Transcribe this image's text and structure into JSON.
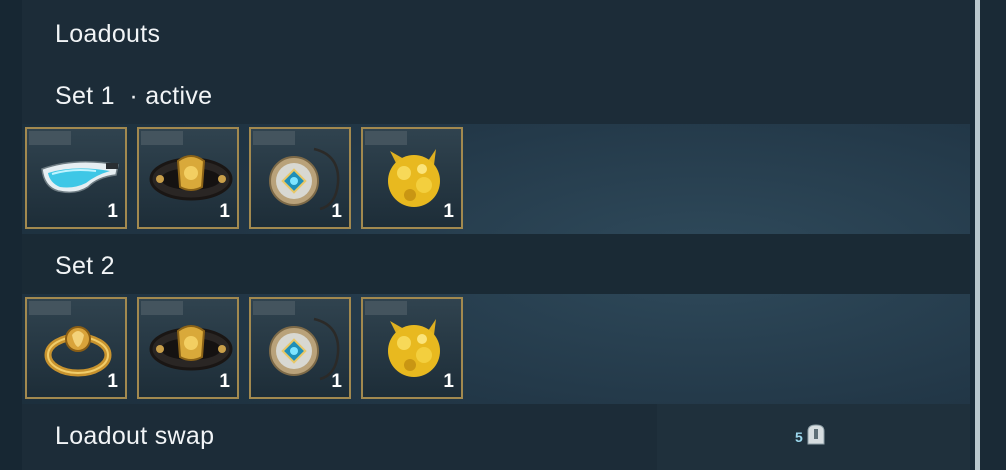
{
  "header": {
    "title": "Loadouts"
  },
  "sets": [
    {
      "label": "Set 1",
      "status": "· active",
      "slots": [
        {
          "icon": "visor-glasses-icon",
          "count": "1"
        },
        {
          "icon": "gold-bracer-icon",
          "count": "1"
        },
        {
          "icon": "medallion-pendant-icon",
          "count": "1"
        },
        {
          "icon": "gold-ore-charm-icon",
          "count": "1"
        }
      ]
    },
    {
      "label": "Set 2",
      "slots": [
        {
          "icon": "golden-ring-icon",
          "count": "1"
        },
        {
          "icon": "gold-bracer-icon",
          "count": "1"
        },
        {
          "icon": "medallion-pendant-icon",
          "count": "1"
        },
        {
          "icon": "gold-ore-charm-icon",
          "count": "1"
        }
      ]
    }
  ],
  "swap": {
    "label": "Loadout swap",
    "cost": "5",
    "cost_icon": "key-token-icon"
  },
  "colors": {
    "slot_border": "#a2894f",
    "panel": "#1c2c38",
    "scrollbar": "#b9c6cc"
  }
}
